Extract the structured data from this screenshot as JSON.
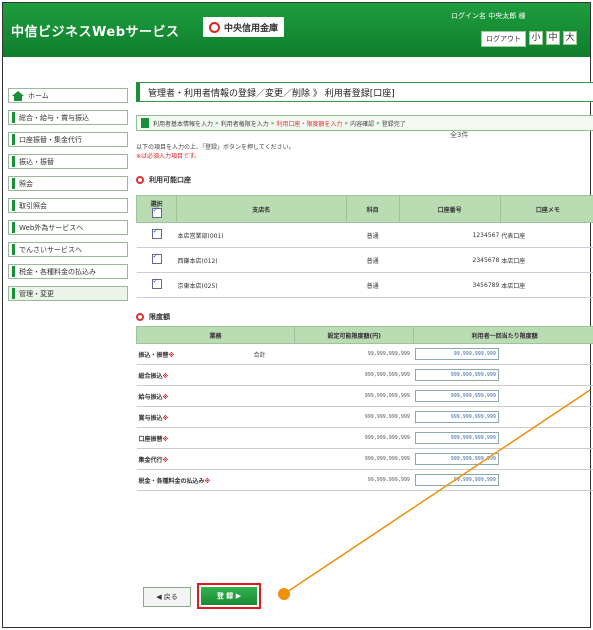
{
  "header": {
    "brand": "中信ビジネスWebサービス",
    "bank_name": "中央信用金庫",
    "user_info": "ログイン名 中央太郎 様",
    "logout_label": "ログアウト",
    "font_small": "小",
    "font_large": "大"
  },
  "sidebar": {
    "items": [
      {
        "label": "ホーム"
      },
      {
        "label": "総合・給与・賞与振込"
      },
      {
        "label": "口座振替・集金代行"
      },
      {
        "label": "振込・振替"
      },
      {
        "label": "照会"
      },
      {
        "label": "取引照会"
      },
      {
        "label": "Web外為サービスへ"
      },
      {
        "label": "でんさいサービスへ"
      },
      {
        "label": "税金・各種料金の払込み"
      },
      {
        "label": "管理・変更"
      }
    ]
  },
  "main": {
    "title": "管理者・利用者情報の登録／変更／削除 》 利用者登録[口座]",
    "steps": [
      "利用者基本情報を入力",
      "利用者権限を入力",
      "利用口座・限度額を入力",
      "内容確認",
      "登録完了"
    ],
    "current_step_index": 2,
    "instructions": [
      "以下の項目を入力の上、「登録」ボタンを押してください。",
      "※は必須入力項目です。"
    ],
    "account_section": {
      "title": "利用可能口座",
      "count_label": "全3件",
      "columns": [
        "選択",
        "支店名",
        "科目",
        "口座番号",
        "口座メモ"
      ],
      "rows": [
        {
          "branch": "本店営業部(001)",
          "type": "普通",
          "number": "1234567",
          "memo": "代表口座"
        },
        {
          "branch": "西鎌本店(012)",
          "type": "普通",
          "number": "2345678",
          "memo": "本店口座"
        },
        {
          "branch": "京東本店(025)",
          "type": "普通",
          "number": "3456789",
          "memo": "本店口座"
        }
      ]
    },
    "limit_section": {
      "title": "限度額",
      "columns": [
        "業務",
        "設定可能限度額(円)",
        "利用者一回当たり限度額"
      ],
      "rows": [
        {
          "name": "振込・振替",
          "sub": "合計",
          "max": "99,999,999,999",
          "value": "99,999,999,999"
        },
        {
          "name": "総合振込",
          "sub": "",
          "max": "999,999,999,999",
          "value": "999,999,999,999"
        },
        {
          "name": "給与振込",
          "sub": "",
          "max": "999,999,999,999",
          "value": "999,999,999,999"
        },
        {
          "name": "賞与振込",
          "sub": "",
          "max": "999,999,999,999",
          "value": "999,999,999,999"
        },
        {
          "name": "口座振替",
          "sub": "",
          "max": "999,999,999,999",
          "value": "999,999,999,999"
        },
        {
          "name": "集金代行",
          "sub": "",
          "max": "999,999,999,999",
          "value": "999,999,999,999"
        },
        {
          "name": "税金・各種料金の払込み",
          "sub": "",
          "max": "99,999,999,999",
          "value": "99,999,999,999"
        }
      ]
    },
    "back_label": "戻る",
    "register_label": "登 録"
  },
  "colors": {
    "accent": "#1a8f3a",
    "callout": "#f0900a",
    "highlight": "#e01b1b"
  }
}
